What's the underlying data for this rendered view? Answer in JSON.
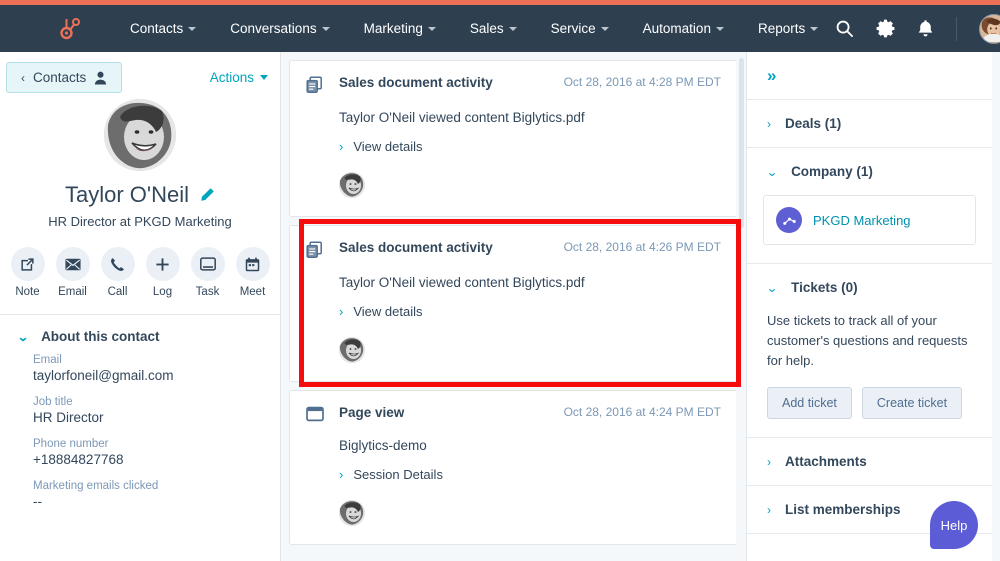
{
  "nav": {
    "logo_icon": "hubspot-sprocket-logo",
    "items": [
      {
        "label": "Contacts",
        "icon": "chevron-down-icon"
      },
      {
        "label": "Conversations",
        "icon": "chevron-down-icon"
      },
      {
        "label": "Marketing",
        "icon": "chevron-down-icon"
      },
      {
        "label": "Sales",
        "icon": "chevron-down-icon"
      },
      {
        "label": "Service",
        "icon": "chevron-down-icon"
      },
      {
        "label": "Automation",
        "icon": "chevron-down-icon"
      },
      {
        "label": "Reports",
        "icon": "chevron-down-icon"
      }
    ],
    "search_icon": "search-icon",
    "settings_icon": "gear-icon",
    "notifications_icon": "bell-icon",
    "avatar_icon": "user-avatar",
    "account_caret_icon": "chevron-down-icon"
  },
  "left_panel": {
    "back_label": "Contacts",
    "back_icon": "chevron-left-icon",
    "back_person_icon": "person-icon",
    "actions_label": "Actions",
    "actions_caret_icon": "chevron-down-icon",
    "avatar_icon": "contact-avatar-photo",
    "contact_name": "Taylor O'Neil",
    "edit_icon": "pencil-icon",
    "contact_subtitle": "HR Director at PKGD Marketing",
    "quick_actions": [
      {
        "label": "Note",
        "icon": "note-icon"
      },
      {
        "label": "Email",
        "icon": "envelope-icon"
      },
      {
        "label": "Call",
        "icon": "phone-icon"
      },
      {
        "label": "Log",
        "icon": "plus-icon"
      },
      {
        "label": "Task",
        "icon": "task-window-icon"
      },
      {
        "label": "Meet",
        "icon": "calendar-icon"
      }
    ],
    "about_title": "About this contact",
    "about_chevron_icon": "chevron-down-icon",
    "properties": [
      {
        "label": "Email",
        "value": "taylorfoneil@gmail.com"
      },
      {
        "label": "Job title",
        "value": "HR Director"
      },
      {
        "label": "Phone number",
        "value": "+18884827768"
      },
      {
        "label": "Marketing emails clicked",
        "value": "--"
      }
    ]
  },
  "timeline": {
    "cards": [
      {
        "icon": "documents-stack-icon",
        "title": "Sales document activity",
        "time": "Oct 28, 2016 at 4:28 PM EDT",
        "body_text": "Taylor O'Neil viewed content Biglytics.pdf",
        "body_link": "",
        "expand_label": "View details",
        "expand_icon": "chevron-right-icon",
        "avatar_icon": "contact-avatar-photo",
        "highlighted": false
      },
      {
        "icon": "documents-stack-icon",
        "title": "Sales document activity",
        "time": "Oct 28, 2016 at 4:26 PM EDT",
        "body_text": "Taylor O'Neil viewed content Biglytics.pdf",
        "body_link": "",
        "expand_label": "View details",
        "expand_icon": "chevron-right-icon",
        "avatar_icon": "contact-avatar-photo",
        "highlighted": true
      },
      {
        "icon": "browser-window-icon",
        "title": "Page view",
        "time": "Oct 28, 2016 at 4:24 PM EDT",
        "body_text": "",
        "body_link": "Biglytics-demo",
        "expand_label": "Session Details",
        "expand_icon": "chevron-right-icon",
        "avatar_icon": "contact-avatar-photo",
        "highlighted": false
      }
    ],
    "highlight_color": "#f50d0d"
  },
  "right_panel": {
    "collapse_icon": "double-chevron-right-icon",
    "deals_title": "Deals (1)",
    "deals_chevron_icon": "chevron-right-icon",
    "company_title": "Company (1)",
    "company_chevron_icon": "chevron-down-icon",
    "company_name": "PKGD Marketing",
    "company_avatar_icon": "company-logo-icon",
    "tickets_title": "Tickets (0)",
    "tickets_chevron_icon": "chevron-down-icon",
    "tickets_description": "Use tickets to track all of your customer's questions and requests for help.",
    "add_ticket_label": "Add ticket",
    "create_ticket_label": "Create ticket",
    "attachments_title": "Attachments",
    "attachments_chevron_icon": "chevron-right-icon",
    "list_memberships_title": "List memberships",
    "list_memberships_chevron_icon": "chevron-right-icon"
  },
  "help": {
    "label": "Help"
  },
  "colors": {
    "brand_orange": "#ec7056",
    "nav_navy": "#2e3f50",
    "teal": "#00a4bd",
    "link_blue": "#0091ae",
    "text_dark": "#33475b",
    "highlight_red": "#f50d0d",
    "help_purple": "#5c5cd6",
    "company_avatar_purple": "#5f5fd4"
  }
}
